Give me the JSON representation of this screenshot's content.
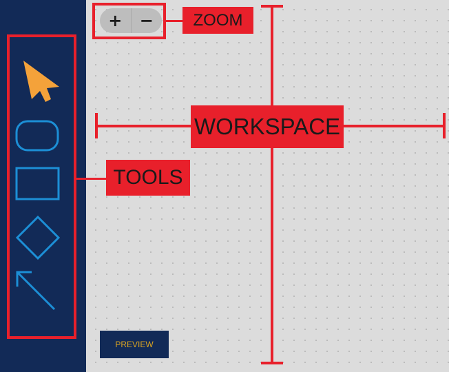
{
  "zoom": {
    "in_label": "+",
    "out_label": "−"
  },
  "tools": [
    {
      "name": "pointer",
      "icon": "pointer-arrow-icon",
      "color": "#f4a23a"
    },
    {
      "name": "rounded-rectangle",
      "icon": "rounded-rectangle-icon",
      "color": "#1c8fd6"
    },
    {
      "name": "rectangle",
      "icon": "rectangle-icon",
      "color": "#1c8fd6"
    },
    {
      "name": "diamond",
      "icon": "diamond-icon",
      "color": "#1c8fd6"
    },
    {
      "name": "connector-arrow",
      "icon": "connector-arrow-icon",
      "color": "#1c8fd6"
    }
  ],
  "preview_button": {
    "label": "PREVIEW",
    "text_color": "#d9a322"
  },
  "annotations": {
    "zoom": "ZOOM",
    "workspace": "WORKSPACE",
    "tools": "TOOLS",
    "color": "#e8202b"
  },
  "colors": {
    "sidebar": "#122a57",
    "workspace": "#dcdcdc"
  }
}
